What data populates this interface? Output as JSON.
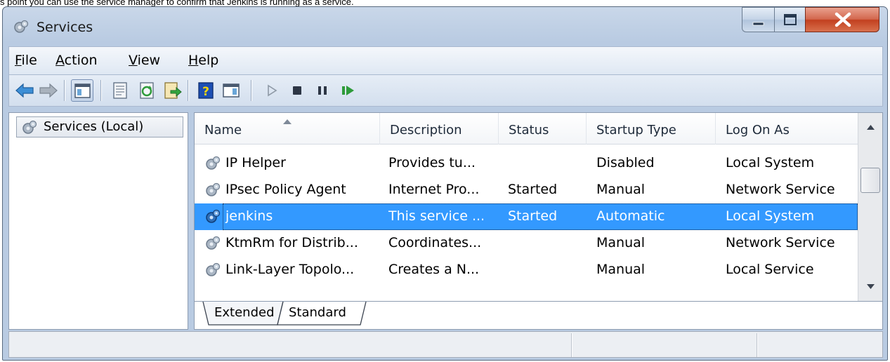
{
  "caption": "s point you can use the service manager to confirm that Jenkins is running as a service.",
  "window": {
    "title": "Services",
    "icon": "gear-icon"
  },
  "menu": {
    "file": "File",
    "action": "Action",
    "view": "View",
    "help": "Help"
  },
  "tree": {
    "root_label": "Services (Local)"
  },
  "columns": {
    "name": "Name",
    "description": "Description",
    "status": "Status",
    "startup_type": "Startup Type",
    "log_on_as": "Log On As"
  },
  "rows": [
    {
      "name": "IP Helper",
      "description": "Provides tu...",
      "status": "",
      "startup_type": "Disabled",
      "log_on_as": "Local System"
    },
    {
      "name": "IPsec Policy Agent",
      "description": "Internet Pro...",
      "status": "Started",
      "startup_type": "Manual",
      "log_on_as": "Network Service"
    },
    {
      "name": "jenkins",
      "description": "This service ...",
      "status": "Started",
      "startup_type": "Automatic",
      "log_on_as": "Local System"
    },
    {
      "name": "KtmRm for Distrib...",
      "description": "Coordinates...",
      "status": "",
      "startup_type": "Manual",
      "log_on_as": "Network Service"
    },
    {
      "name": "Link-Layer Topolo...",
      "description": "Creates a N...",
      "status": "",
      "startup_type": "Manual",
      "log_on_as": "Local Service"
    }
  ],
  "selected_row": "jenkins",
  "tabs": {
    "extended": "Extended",
    "standard": "Standard",
    "active": "Standard"
  },
  "colors": {
    "selection": "#3399ff",
    "frame": "#b9cbe2",
    "close_button": "#c2401f"
  }
}
